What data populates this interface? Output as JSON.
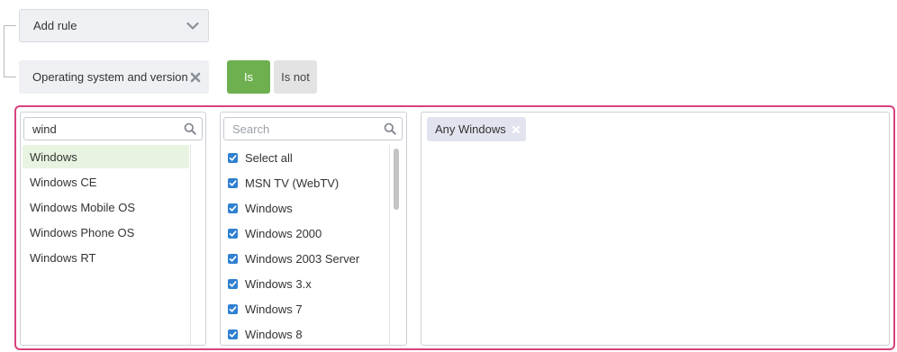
{
  "rule_builder": {
    "add_rule_label": "Add rule",
    "condition_label": "Operating system and version",
    "is_label": "Is",
    "is_not_label": "Is not"
  },
  "families_panel": {
    "search_value": "wind",
    "items": [
      "Windows",
      "Windows CE",
      "Windows Mobile OS",
      "Windows Phone OS",
      "Windows RT"
    ],
    "selected": "Windows"
  },
  "versions_panel": {
    "search_placeholder": "Search",
    "items": [
      "Select all",
      "MSN TV (WebTV)",
      "Windows",
      "Windows 2000",
      "Windows 2003 Server",
      "Windows 3.x",
      "Windows 7",
      "Windows 8"
    ]
  },
  "selected_panel": {
    "tags": [
      "Any Windows"
    ]
  },
  "colors": {
    "accent_green": "#6eb04f",
    "highlight_border": "#d9417f",
    "checkbox_blue": "#2f80d1"
  }
}
